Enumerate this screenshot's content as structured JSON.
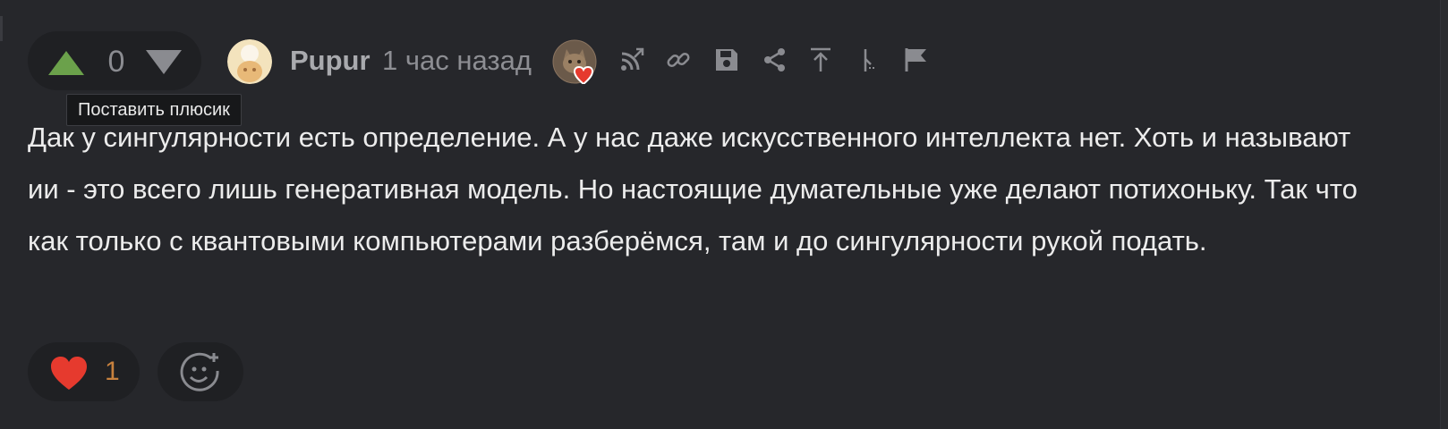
{
  "rating": {
    "score": "0",
    "upvote_tooltip": "Поставить плюсик"
  },
  "author": {
    "name": "Pupur",
    "time": "1 час назад"
  },
  "actions": [
    {
      "icon": "reply-branch-icon"
    },
    {
      "icon": "link-icon"
    },
    {
      "icon": "save-icon"
    },
    {
      "icon": "share-icon"
    },
    {
      "icon": "go-to-parent-icon"
    },
    {
      "icon": "thread-icon"
    },
    {
      "icon": "flag-icon"
    }
  ],
  "comment": {
    "text": "Дак у сингулярности есть определение. А у нас даже искусственного интеллекта нет. Хоть и называют ии - это всего лишь генеративная модель. Но настоящие думательные уже делают потихоньку. Так что как только с квантовыми компьютерами разберёмся, там и до сингулярности рукой подать."
  },
  "reactions": {
    "likes": "1"
  },
  "colors": {
    "background": "#26272b",
    "upvote": "#6ba14b",
    "downvote": "#8a8b90",
    "heart": "#e63a2e",
    "like_count": "#c7813e"
  }
}
